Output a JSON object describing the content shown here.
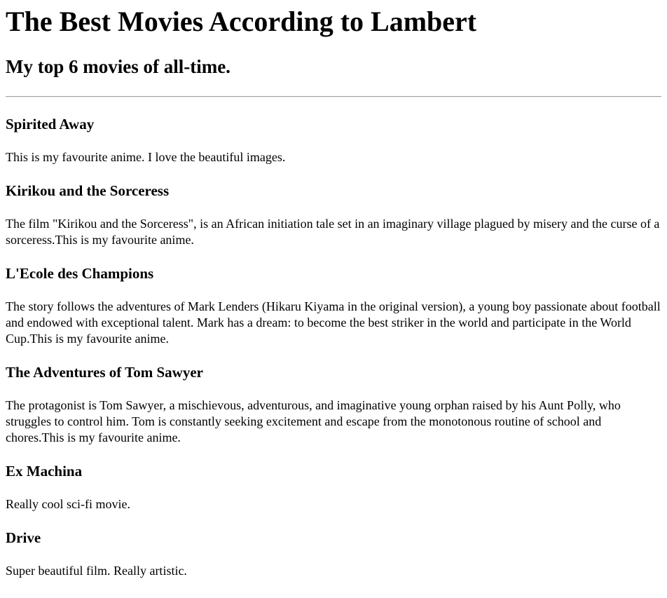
{
  "page": {
    "title": "The Best Movies According to Lambert",
    "subtitle": "My top 6 movies of all-time."
  },
  "movies": [
    {
      "title": "Spirited Away",
      "description": "This is my favourite anime. I love the beautiful images."
    },
    {
      "title": "Kirikou and the Sorceress",
      "description": "The film \"Kirikou and the Sorceress\", is an African initiation tale set in an imaginary village plagued by misery and the curse of a sorceress.This is my favourite anime."
    },
    {
      "title": "L'Ecole des Champions",
      "description": "The story follows the adventures of Mark Lenders (Hikaru Kiyama in the original version), a young boy passionate about football and endowed with exceptional talent. Mark has a dream: to become the best striker in the world and participate in the World Cup.This is my favourite anime."
    },
    {
      "title": "The Adventures of Tom Sawyer",
      "description": "The protagonist is Tom Sawyer, a mischievous, adventurous, and imaginative young orphan raised by his Aunt Polly, who struggles to control him. Tom is constantly seeking excitement and escape from the monotonous routine of school and chores.This is my favourite anime."
    },
    {
      "title": "Ex Machina",
      "description": "Really cool sci-fi movie."
    },
    {
      "title": "Drive",
      "description": "Super beautiful film. Really artistic."
    }
  ]
}
